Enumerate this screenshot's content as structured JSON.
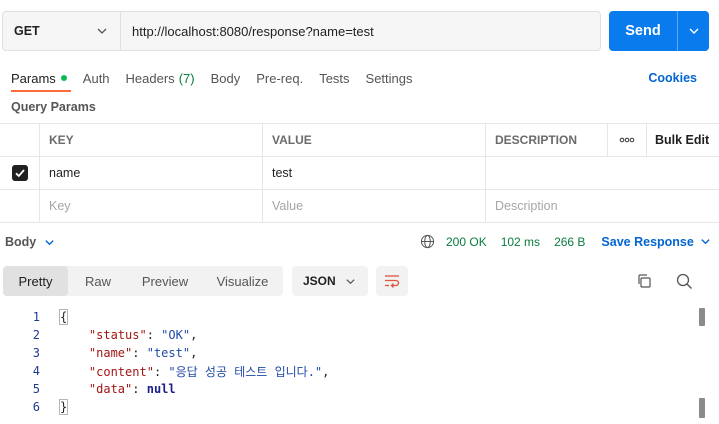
{
  "request": {
    "method": "GET",
    "url": "http://localhost:8080/response?name=test",
    "send_label": "Send"
  },
  "tabs": [
    {
      "label": "Params",
      "active": true,
      "dot": true
    },
    {
      "label": "Auth"
    },
    {
      "label": "Headers",
      "count": "(7)"
    },
    {
      "label": "Body"
    },
    {
      "label": "Pre-req."
    },
    {
      "label": "Tests"
    },
    {
      "label": "Settings"
    }
  ],
  "cookies_label": "Cookies",
  "query_params_title": "Query Params",
  "params_table": {
    "headers": {
      "key": "KEY",
      "value": "VALUE",
      "description": "DESCRIPTION",
      "more": "ooo",
      "bulk_edit": "Bulk Edit"
    },
    "rows": [
      {
        "checked": true,
        "key": "name",
        "value": "test",
        "description": ""
      }
    ],
    "placeholders": {
      "key": "Key",
      "value": "Value",
      "description": "Description"
    }
  },
  "response": {
    "body_label": "Body",
    "status": "200 OK",
    "time": "102 ms",
    "size": "266 B",
    "save_label": "Save Response"
  },
  "viewer": {
    "modes": [
      "Pretty",
      "Raw",
      "Preview",
      "Visualize"
    ],
    "active_mode": "Pretty",
    "format": "JSON"
  },
  "code_lines": [
    {
      "n": "1",
      "text": "{"
    },
    {
      "n": "2",
      "key": "\"status\"",
      "value": "\"OK\"",
      "comma": ","
    },
    {
      "n": "3",
      "key": "\"name\"",
      "value": "\"test\"",
      "comma": ","
    },
    {
      "n": "4",
      "key": "\"content\"",
      "value": "\"응답 성공 테스트 입니다.\"",
      "comma": ","
    },
    {
      "n": "5",
      "key": "\"data\"",
      "value": "null",
      "comma": ""
    },
    {
      "n": "6",
      "text": "}"
    }
  ],
  "colors": {
    "accent": "#097bed",
    "link": "#0265d2",
    "active_tab": "#ff6c37",
    "success": "#0a7b3c"
  }
}
